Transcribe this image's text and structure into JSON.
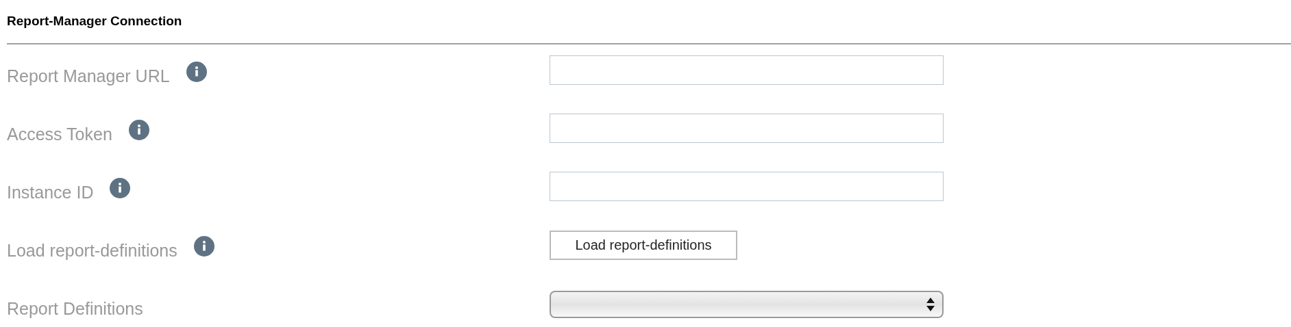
{
  "section": {
    "title": "Report-Manager Connection"
  },
  "rows": [
    {
      "label": "Report Manager URL",
      "info": true,
      "kind": "text"
    },
    {
      "label": "Access Token",
      "info": true,
      "kind": "text"
    },
    {
      "label": "Instance ID",
      "info": true,
      "kind": "text"
    },
    {
      "label": "Load report-definitions",
      "info": true,
      "kind": "button",
      "button_label": "Load report-definitions"
    },
    {
      "label": "Report Definitions",
      "info": false,
      "kind": "select"
    }
  ]
}
